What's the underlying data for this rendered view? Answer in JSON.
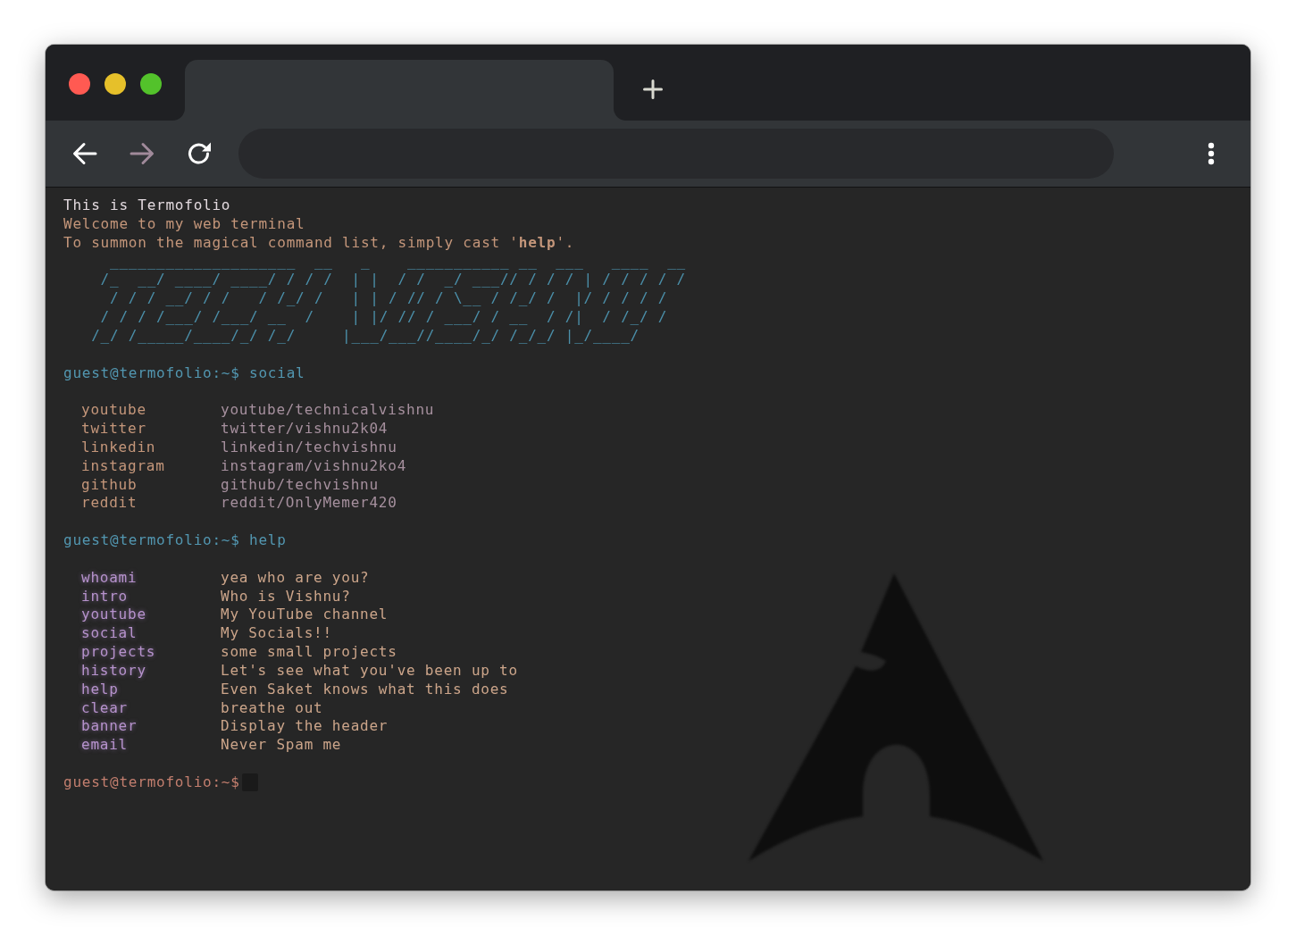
{
  "window": {
    "controls": [
      {
        "color": "#ff5a52"
      },
      {
        "color": "#e6c02a"
      },
      {
        "color": "#53c22b"
      }
    ]
  },
  "toolbar": {
    "nav_buttons": [
      {
        "kind": "back",
        "disabled": false
      },
      {
        "kind": "forward",
        "disabled": true
      },
      {
        "kind": "reload",
        "disabled": false
      }
    ]
  },
  "terminal": {
    "banner": {
      "title": "This is Termofolio",
      "lines": [
        "Welcome to my web terminal",
        "To summon the magical command list, simply cast '**help**'."
      ],
      "art": [
        "     ____________________  __   _    ___________ __  ___   ____  __",
        "    /_  __/ ____/ ____/ / / /  | |  / /  _/ ___// / / / | / / / / /",
        "     / / / __/ / /   / /_/ /   | | / // / \\__ / /_/ /  |/ / / / /",
        "    / / / /___/ /___/ __  /    | |/ // / ___/ / __  / /|  / /_/ /",
        "   /_/ /_____/____/_/ /_/     |___/___//____/_/ /_/_/ |_/____/"
      ]
    },
    "sessions": [
      {
        "prompt": "guest@termofolio:~$",
        "command": "social",
        "active": false,
        "output": {
          "kind": "links",
          "rows": [
            {
              "name": "youtube",
              "value": "youtube/technicalvishnu"
            },
            {
              "name": "twitter",
              "value": "twitter/vishnu2k04"
            },
            {
              "name": "linkedin",
              "value": "linkedin/techvishnu"
            },
            {
              "name": "instagram",
              "value": "instagram/vishnu2ko4"
            },
            {
              "name": "github",
              "value": "github/techvishnu"
            },
            {
              "name": "reddit",
              "value": "reddit/OnlyMemer420"
            }
          ]
        }
      },
      {
        "prompt": "guest@termofolio:~$",
        "command": "help",
        "active": false,
        "output": {
          "kind": "commands",
          "rows": [
            {
              "name": "whoami",
              "value": "yea who are you?"
            },
            {
              "name": "intro",
              "value": "Who is Vishnu?"
            },
            {
              "name": "youtube",
              "value": "My YouTube channel"
            },
            {
              "name": "social",
              "value": "My Socials!!"
            },
            {
              "name": "projects",
              "value": "some small projects"
            },
            {
              "name": "history",
              "value": "Let's see what you've been up to"
            },
            {
              "name": "help",
              "value": "Even Saket knows what this does"
            },
            {
              "name": "clear",
              "value": "breathe out"
            },
            {
              "name": "banner",
              "value": "Display the header"
            },
            {
              "name": "email",
              "value": "Never Spam me"
            }
          ]
        }
      },
      {
        "prompt": "guest@termofolio:~$",
        "active": true
      }
    ]
  }
}
